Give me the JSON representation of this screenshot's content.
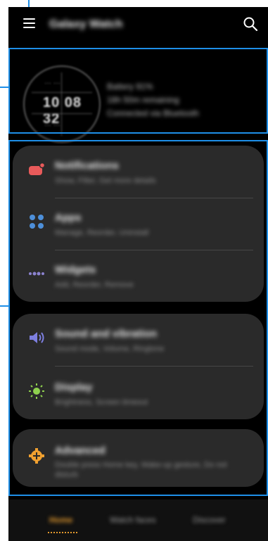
{
  "header": {
    "title": "Galaxy Watch",
    "menu_icon": "menu-icon",
    "search_icon": "search-icon"
  },
  "watch": {
    "time": "10 08 32",
    "top_marks": "…  …",
    "bottom_marks": "…  …",
    "status_lines": [
      "Battery 91%",
      "18h 50m remaining",
      "Connected via Bluetooth"
    ]
  },
  "groups": [
    {
      "items": [
        {
          "title": "Notifications",
          "subtitle": "Show, Filter, Get more details",
          "icon": "notifications-icon",
          "color": "#e85a5a"
        },
        {
          "title": "Apps",
          "subtitle": "Manage, Reorder, Uninstall",
          "icon": "apps-icon",
          "color": "#4d8fd9"
        },
        {
          "title": "Widgets",
          "subtitle": "Add, Reorder, Remove",
          "icon": "widgets-icon",
          "color": "#8b82cf"
        }
      ]
    },
    {
      "items": [
        {
          "title": "Sound and vibration",
          "subtitle": "Sound mode, Volume, Ringtone",
          "icon": "sound-icon",
          "color": "#7d7fe0"
        },
        {
          "title": "Display",
          "subtitle": "Brightness, Screen timeout",
          "icon": "display-icon",
          "color": "#8fd14f"
        }
      ]
    },
    {
      "items": [
        {
          "title": "Advanced",
          "subtitle": "Double press Home key, Wake-up gesture, Do not disturb",
          "icon": "advanced-icon",
          "color": "#f0a030"
        }
      ]
    }
  ],
  "bottom_nav": {
    "tabs": [
      {
        "label": "Home",
        "active": true
      },
      {
        "label": "Watch faces",
        "active": false
      },
      {
        "label": "Discover",
        "active": false
      }
    ],
    "active_color": "#e49a2e"
  },
  "accent": "#1e8fe8"
}
